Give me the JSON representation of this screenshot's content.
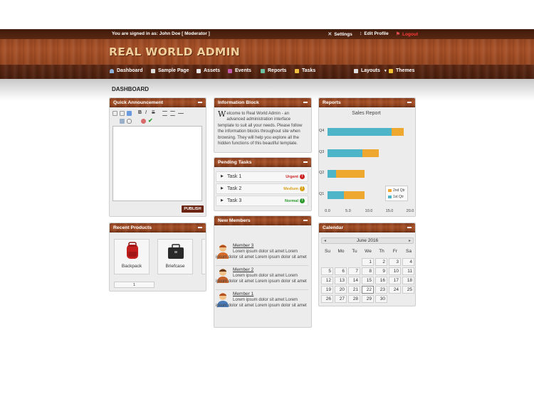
{
  "header": {
    "signed_in": "You are signed in as: John Doe [ Moderator ]",
    "settings": "Settings",
    "edit_profile": "Edit Profile",
    "logout": "Logout",
    "logo": "REAL WORLD ADMIN"
  },
  "nav": {
    "dashboard": "Dashboard",
    "sample_page": "Sample Page",
    "assets": "Assets",
    "events": "Events",
    "reports": "Reports",
    "tasks": "Tasks",
    "layouts": "Layouts",
    "themes": "Themes"
  },
  "page_title": "DASHBOARD",
  "panels": {
    "quick_announcement": "Quick Announcement",
    "information_block": "Information Block",
    "reports": "Reports",
    "pending_tasks": "Pending Tasks",
    "recent_products": "Recent Products",
    "new_members": "New Members",
    "calendar": "Calendar"
  },
  "editor": {
    "publish": "PUBLISH"
  },
  "info": {
    "dropcap": "W",
    "text": "elcome to Real World Admin - an advanced administration interface template to suit all your needs. Please follow the information blocks throughout site when browsing. They will help you explore all the hidden functions of this beautiful template."
  },
  "tasks": [
    {
      "name": "Task 1",
      "status": "Urgent",
      "color": "#cc2222"
    },
    {
      "name": "Task 2",
      "status": "Medium",
      "color": "#d9a21a"
    },
    {
      "name": "Task 3",
      "status": "Normal",
      "color": "#2e9a2e"
    }
  ],
  "products": [
    {
      "name": "Backpack",
      "icon": "backpack-icon"
    },
    {
      "name": "Briefcase",
      "icon": "briefcase-icon"
    }
  ],
  "pager": "1",
  "members": [
    {
      "name": "Member 3",
      "text": "Lorem ipsum dolor sit amet Lorem ipsum dolor sit amet Lorem ipsum dolor sit amet"
    },
    {
      "name": "Member 2",
      "text": "Lorem ipsum dolor sit amet Lorem ipsum dolor sit amet Lorem ipsum dolor sit amet"
    },
    {
      "name": "Member 1",
      "text": "Lorem ipsum dolor sit amet Lorem ipsum dolor sit amet Lorem ipsum dolor sit amet"
    }
  ],
  "calendar": {
    "month": "June 2016",
    "dow": [
      "Su",
      "Mo",
      "Tu",
      "We",
      "Th",
      "Fr",
      "Sa"
    ],
    "weeks": [
      [
        "",
        "",
        "",
        "1",
        "2",
        "3",
        "4"
      ],
      [
        "5",
        "6",
        "7",
        "8",
        "9",
        "10",
        "11"
      ],
      [
        "12",
        "13",
        "14",
        "15",
        "16",
        "17",
        "18"
      ],
      [
        "19",
        "20",
        "21",
        "22",
        "23",
        "24",
        "25"
      ],
      [
        "26",
        "27",
        "28",
        "29",
        "30",
        "",
        ""
      ]
    ],
    "today": "22"
  },
  "chart_data": {
    "type": "bar",
    "orientation": "horizontal",
    "stacked": true,
    "title": "Sales Report",
    "categories": [
      "Q4",
      "Q3",
      "Q2",
      "Q1"
    ],
    "series": [
      {
        "name": "1st Qtr",
        "color": "#4eb4c8",
        "values": [
          15.5,
          8.5,
          2.0,
          4.0
        ]
      },
      {
        "name": "2nd Qtr",
        "color": "#eea72f",
        "values": [
          3.0,
          4.0,
          7.0,
          5.0
        ]
      }
    ],
    "xlim": [
      0,
      20
    ],
    "xticks": [
      "0.0",
      "5.0",
      "10.0",
      "15.0",
      "20.0"
    ],
    "legend_position": "bottom-right"
  }
}
